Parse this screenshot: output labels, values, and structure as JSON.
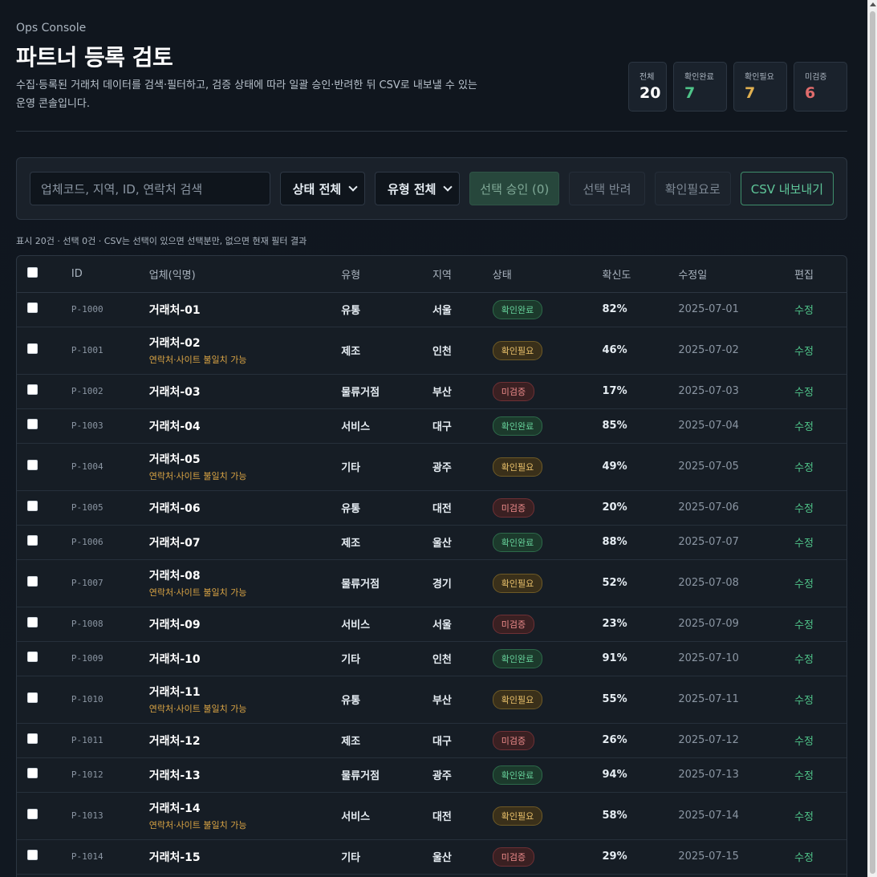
{
  "header": {
    "app_name": "Ops Console",
    "title": "파트너 등록 검토",
    "description": "수집·등록된 거래처 데이터를 검색·필터하고, 검증 상태에 따라 일괄 승인·반려한 뒤 CSV로 내보낼 수 있는 운영 콘솔입니다."
  },
  "stats": [
    {
      "label": "전체",
      "value": "20"
    },
    {
      "label": "확인완료",
      "value": "7"
    },
    {
      "label": "확인필요",
      "value": "7"
    },
    {
      "label": "미검증",
      "value": "6"
    }
  ],
  "toolbar": {
    "search_placeholder": "업체코드, 지역, ID, 연락처 검색",
    "status_select": "상태 전체",
    "type_select": "유형 전체",
    "approve_label": "선택 승인 (0)",
    "reject_label": "선택 반려",
    "need_check_label": "확인필요로",
    "csv_label": "CSV 내보내기"
  },
  "summary": "표시 20건 · 선택 0건 · CSV는 선택이 있으면 선택분만, 없으면 현재 필터 결과",
  "table": {
    "headers": {
      "id": "ID",
      "name": "업체(익명)",
      "type": "유형",
      "region": "지역",
      "status": "상태",
      "confidence": "확신도",
      "modified": "수정일",
      "edit": "편집"
    },
    "rows": [
      {
        "id": "P-1000",
        "name": "거래처-01",
        "warning": "",
        "type": "유통",
        "region": "서울",
        "status": "확인완료",
        "status_kind": "ok",
        "confidence": "82%",
        "modified": "2025-07-01",
        "edit": "수정"
      },
      {
        "id": "P-1001",
        "name": "거래처-02",
        "warning": "연락처·사이트 불일치 가능",
        "type": "제조",
        "region": "인천",
        "status": "확인필요",
        "status_kind": "need",
        "confidence": "46%",
        "modified": "2025-07-02",
        "edit": "수정"
      },
      {
        "id": "P-1002",
        "name": "거래처-03",
        "warning": "",
        "type": "물류거점",
        "region": "부산",
        "status": "미검증",
        "status_kind": "unv",
        "confidence": "17%",
        "modified": "2025-07-03",
        "edit": "수정"
      },
      {
        "id": "P-1003",
        "name": "거래처-04",
        "warning": "",
        "type": "서비스",
        "region": "대구",
        "status": "확인완료",
        "status_kind": "ok",
        "confidence": "85%",
        "modified": "2025-07-04",
        "edit": "수정"
      },
      {
        "id": "P-1004",
        "name": "거래처-05",
        "warning": "연락처·사이트 불일치 가능",
        "type": "기타",
        "region": "광주",
        "status": "확인필요",
        "status_kind": "need",
        "confidence": "49%",
        "modified": "2025-07-05",
        "edit": "수정"
      },
      {
        "id": "P-1005",
        "name": "거래처-06",
        "warning": "",
        "type": "유통",
        "region": "대전",
        "status": "미검증",
        "status_kind": "unv",
        "confidence": "20%",
        "modified": "2025-07-06",
        "edit": "수정"
      },
      {
        "id": "P-1006",
        "name": "거래처-07",
        "warning": "",
        "type": "제조",
        "region": "울산",
        "status": "확인완료",
        "status_kind": "ok",
        "confidence": "88%",
        "modified": "2025-07-07",
        "edit": "수정"
      },
      {
        "id": "P-1007",
        "name": "거래처-08",
        "warning": "연락처·사이트 불일치 가능",
        "type": "물류거점",
        "region": "경기",
        "status": "확인필요",
        "status_kind": "need",
        "confidence": "52%",
        "modified": "2025-07-08",
        "edit": "수정"
      },
      {
        "id": "P-1008",
        "name": "거래처-09",
        "warning": "",
        "type": "서비스",
        "region": "서울",
        "status": "미검증",
        "status_kind": "unv",
        "confidence": "23%",
        "modified": "2025-07-09",
        "edit": "수정"
      },
      {
        "id": "P-1009",
        "name": "거래처-10",
        "warning": "",
        "type": "기타",
        "region": "인천",
        "status": "확인완료",
        "status_kind": "ok",
        "confidence": "91%",
        "modified": "2025-07-10",
        "edit": "수정"
      },
      {
        "id": "P-1010",
        "name": "거래처-11",
        "warning": "연락처·사이트 불일치 가능",
        "type": "유통",
        "region": "부산",
        "status": "확인필요",
        "status_kind": "need",
        "confidence": "55%",
        "modified": "2025-07-11",
        "edit": "수정"
      },
      {
        "id": "P-1011",
        "name": "거래처-12",
        "warning": "",
        "type": "제조",
        "region": "대구",
        "status": "미검증",
        "status_kind": "unv",
        "confidence": "26%",
        "modified": "2025-07-12",
        "edit": "수정"
      },
      {
        "id": "P-1012",
        "name": "거래처-13",
        "warning": "",
        "type": "물류거점",
        "region": "광주",
        "status": "확인완료",
        "status_kind": "ok",
        "confidence": "94%",
        "modified": "2025-07-13",
        "edit": "수정"
      },
      {
        "id": "P-1013",
        "name": "거래처-14",
        "warning": "연락처·사이트 불일치 가능",
        "type": "서비스",
        "region": "대전",
        "status": "확인필요",
        "status_kind": "need",
        "confidence": "58%",
        "modified": "2025-07-14",
        "edit": "수정"
      },
      {
        "id": "P-1014",
        "name": "거래처-15",
        "warning": "",
        "type": "기타",
        "region": "울산",
        "status": "미검증",
        "status_kind": "unv",
        "confidence": "29%",
        "modified": "2025-07-15",
        "edit": "수정"
      }
    ]
  },
  "colors": {
    "accent": "#4fc489",
    "warning": "#d9a444",
    "danger": "#e06c6c",
    "background": "#10161e"
  }
}
